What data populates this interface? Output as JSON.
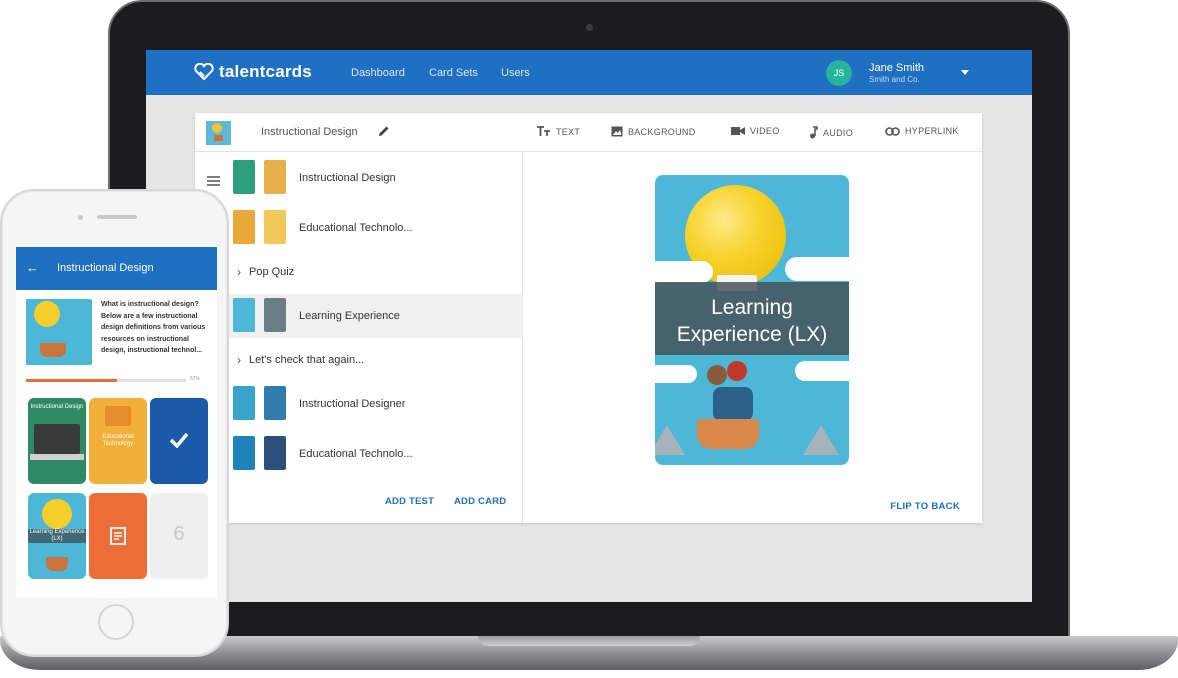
{
  "app": {
    "brand": "talentcards",
    "nav": [
      "Dashboard",
      "Card Sets",
      "Users"
    ],
    "user": {
      "initials": "JS",
      "name": "Jane Smith",
      "org": "Smith and Co."
    }
  },
  "editor": {
    "set_title": "Instructional Design",
    "tools": [
      "TEXT",
      "BACKGROUND",
      "VIDEO",
      "AUDIO",
      "HYPERLINK"
    ],
    "items": [
      {
        "kind": "card",
        "label": "Instructional Design"
      },
      {
        "kind": "card",
        "label": "Educational Technolo..."
      },
      {
        "kind": "section",
        "label": "Pop Quiz"
      },
      {
        "kind": "card",
        "label": "Learning Experience"
      },
      {
        "kind": "section",
        "label": "Let's check that again..."
      },
      {
        "kind": "card",
        "label": "Instructional Designer"
      },
      {
        "kind": "card",
        "label": "Educational Technolo..."
      }
    ],
    "actions": {
      "add_test": "ADD TEST",
      "add_card": "ADD CARD"
    },
    "preview": {
      "line1": "Learning",
      "line2": "Experience (LX)",
      "flip": "FLIP TO BACK"
    }
  },
  "phone": {
    "title": "Instructional Design",
    "back": "←",
    "description": "What is instructional design? Below are a few instructional design definitions from various resources on instructional design, instructional technol...",
    "progress": 0.57,
    "progress_label": "57%",
    "tiles": [
      {
        "label": "Instructional Design"
      },
      {
        "label": "Educational Technology"
      },
      {
        "label": ""
      },
      {
        "label": "Learning Experience (LX)"
      },
      {
        "label": ""
      },
      {
        "label": "6"
      }
    ]
  },
  "colors": {
    "brand_blue": "#1f6fc2",
    "accent_orange": "#ee6d37",
    "avatar_teal": "#28b39c"
  }
}
